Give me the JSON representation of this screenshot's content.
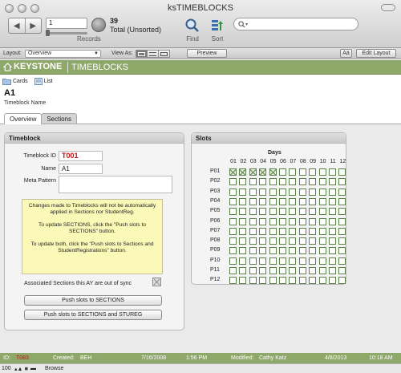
{
  "window": {
    "title": "ksTIMEBLOCKS"
  },
  "toolbar": {
    "record_value": "1",
    "records_label": "Records",
    "found_count": "39",
    "found_label": "Total (Unsorted)",
    "find_label": "Find",
    "sort_label": "Sort",
    "search_placeholder": ""
  },
  "layout_bar": {
    "layout_label": "Layout:",
    "layout_value": "Overview",
    "view_as_label": "View As:",
    "preview_label": "Preview",
    "font_button": "Aä",
    "edit_layout_label": "Edit Layout"
  },
  "header": {
    "brand": "KEYSTONE",
    "app_name": "TIMEBLOCKS"
  },
  "subnav": {
    "cards_label": "Cards",
    "list_label": "List"
  },
  "record": {
    "title": "A1",
    "subtitle": "Timeblock Name"
  },
  "tabs": [
    {
      "label": "Overview"
    },
    {
      "label": "Sections"
    }
  ],
  "timeblock_panel": {
    "title": "Timeblock",
    "id_label": "Timeblock ID",
    "id_value": "T001",
    "name_label": "Name",
    "name_value": "A1",
    "meta_label": "Meta Pattern",
    "meta_value": "",
    "note_p1": "Changes made to Timeblocks will not be automatically applied in Sections nor StudentReg.",
    "note_p2": "To update SECTIONS, click the \"Push slots to SECTIONS\" button.",
    "note_p3": "To update both, click the \"Push slots to Sections and StudentRegistrations\" button.",
    "sync_label": "Associated Sections this AY are out of sync",
    "push_sections_label": "Push slots to SECTIONS",
    "push_both_label": "Push slots to SECTIONS and STUREG"
  },
  "slots_panel": {
    "title": "Slots",
    "days_label": "Days",
    "columns": [
      "01",
      "02",
      "03",
      "04",
      "05",
      "06",
      "07",
      "08",
      "09",
      "10",
      "11",
      "12"
    ],
    "rows": [
      {
        "label": "P01",
        "checked": [
          1,
          1,
          1,
          1,
          1,
          0,
          0,
          0,
          0,
          0,
          0,
          0
        ]
      },
      {
        "label": "P02",
        "checked": [
          0,
          0,
          0,
          0,
          0,
          0,
          0,
          0,
          0,
          0,
          0,
          0
        ]
      },
      {
        "label": "P03",
        "checked": [
          0,
          0,
          0,
          0,
          0,
          0,
          0,
          0,
          0,
          0,
          0,
          0
        ]
      },
      {
        "label": "P04",
        "checked": [
          0,
          0,
          0,
          0,
          0,
          0,
          0,
          0,
          0,
          0,
          0,
          0
        ]
      },
      {
        "label": "P05",
        "checked": [
          0,
          0,
          0,
          0,
          0,
          0,
          0,
          0,
          0,
          0,
          0,
          0
        ]
      },
      {
        "label": "P06",
        "checked": [
          0,
          0,
          0,
          0,
          0,
          0,
          0,
          0,
          0,
          0,
          0,
          0
        ]
      },
      {
        "label": "P07",
        "checked": [
          0,
          0,
          0,
          0,
          0,
          0,
          0,
          0,
          0,
          0,
          0,
          0
        ]
      },
      {
        "label": "P08",
        "checked": [
          0,
          0,
          0,
          0,
          0,
          0,
          0,
          0,
          0,
          0,
          0,
          0
        ]
      },
      {
        "label": "P09",
        "checked": [
          0,
          0,
          0,
          0,
          0,
          0,
          0,
          0,
          0,
          0,
          0,
          0
        ]
      },
      {
        "label": "P10",
        "checked": [
          0,
          0,
          0,
          0,
          0,
          0,
          0,
          0,
          0,
          0,
          0,
          0
        ]
      },
      {
        "label": "P11",
        "checked": [
          0,
          0,
          0,
          0,
          0,
          0,
          0,
          0,
          0,
          0,
          0,
          0
        ]
      },
      {
        "label": "P12",
        "checked": [
          0,
          0,
          0,
          0,
          0,
          0,
          0,
          0,
          0,
          0,
          0,
          0
        ]
      }
    ]
  },
  "footer": {
    "id_label": "ID:",
    "id_value": "T083",
    "created_label": "Created:",
    "created_by": "BEH",
    "created_date": "7/16/2008",
    "created_time": "1:56 PM",
    "modified_label": "Modified:",
    "modified_by": "Cathy Katz",
    "modified_date": "4/8/2013",
    "modified_time": "10:18 AM"
  },
  "statusbar": {
    "zoom": "100",
    "mode": "Browse"
  },
  "colors": {
    "brand_green": "#8ea86a",
    "id_red": "#cc1111",
    "note_yellow": "#fbf9b8"
  }
}
